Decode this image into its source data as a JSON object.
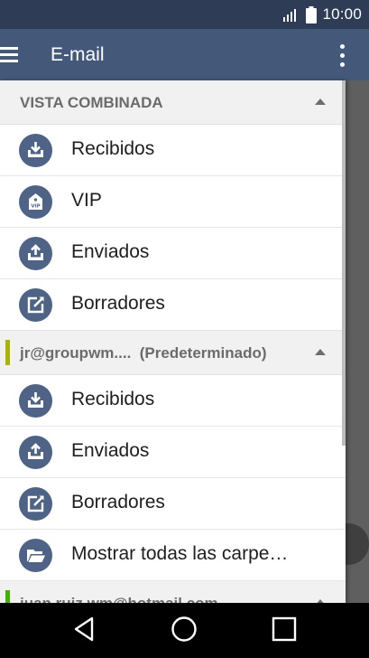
{
  "status": {
    "time": "10:00"
  },
  "appbar": {
    "title": "E-mail"
  },
  "combined": {
    "header": "VISTA COMBINADA",
    "items": [
      {
        "label": "Recibidos",
        "icon": "inbox-icon"
      },
      {
        "label": "VIP",
        "icon": "vip-tag-icon"
      },
      {
        "label": "Enviados",
        "icon": "outbox-icon"
      },
      {
        "label": "Borradores",
        "icon": "draft-edit-icon"
      }
    ]
  },
  "account1": {
    "address": "jr@groupwm....",
    "default_label": "(Predeterminado)",
    "accent_color": "#a8b400",
    "items": [
      {
        "label": "Recibidos",
        "icon": "inbox-icon"
      },
      {
        "label": "Enviados",
        "icon": "outbox-icon"
      },
      {
        "label": "Borradores",
        "icon": "draft-edit-icon"
      },
      {
        "label": "Mostrar todas las carpe…",
        "icon": "folder-open-icon"
      }
    ]
  },
  "account2": {
    "address": "juan.ruiz.wm@hotmail.com",
    "accent_color": "#3cb400"
  },
  "colors": {
    "statusbar": "#2e3d55",
    "appbar": "#44597a",
    "icon_circle": "#4e6385"
  }
}
